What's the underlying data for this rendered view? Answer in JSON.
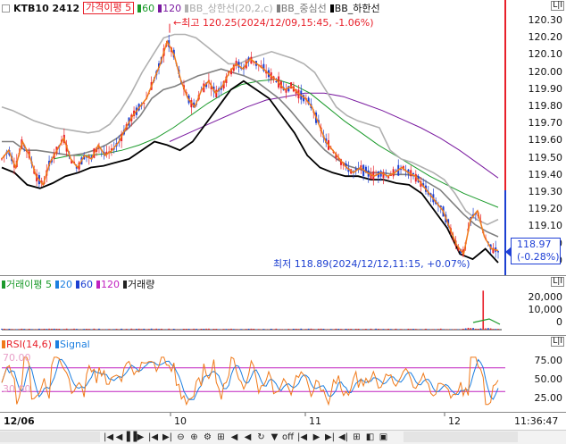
{
  "price_panel": {
    "legend": {
      "symbol": "KTB10 2412",
      "envelope": "가격이평 5",
      "ma60": "60",
      "ma120": "120",
      "bb_upper": "BB_상한선(20,2,c)",
      "bb_mid": "BB_중심선",
      "bb_lower": "BB_하한선"
    },
    "high_annotation": "←최고 120.25(2024/12/09,15:45, -1.06%)",
    "low_annotation": "최저 118.89(2024/12/12,11:15, +0.07%)",
    "current_price": "118.97",
    "current_change": "(-0.28%)",
    "axis_ticks": [
      "120.30",
      "120.20",
      "120.10",
      "120.00",
      "119.90",
      "119.80",
      "119.70",
      "119.60",
      "119.50",
      "119.40",
      "119.30",
      "119.20",
      "119.10",
      "119.00",
      "118.90"
    ]
  },
  "volume_panel": {
    "legend": {
      "title": "거래이평 5",
      "ma20": "20",
      "ma60": "60",
      "ma120": "120",
      "label": "거래량"
    },
    "axis_ticks": [
      "20,000",
      "10,000",
      "0"
    ]
  },
  "rsi_panel": {
    "legend": {
      "rsi": "RSI(14,6)",
      "signal": "Signal"
    },
    "level_high": "70.00",
    "level_low": "30.00",
    "axis_ticks": [
      "75.00",
      "50.00",
      "25.00"
    ]
  },
  "time_axis": {
    "labels": [
      "12/06",
      "10",
      "11",
      "12"
    ],
    "clock": "11:36:47"
  },
  "toolbar": {
    "buttons": [
      "|◀",
      "◀",
      "▐▐",
      "▶",
      "|◀",
      "▶|",
      "⊖",
      "⊕",
      "⚙",
      "⊞",
      "◀",
      "◀",
      "↻",
      "▼",
      "off",
      "|◀",
      "▶",
      "▶|",
      "◀|",
      "⊞",
      "◧",
      "▣"
    ]
  },
  "colors": {
    "candle_up": "#e8202a",
    "candle_down": "#1c3fd1",
    "envelope": "#f07a1a",
    "ma60": "#1a9a2a",
    "ma120": "#7a1aa0",
    "bb_upper": "#b0b0b0",
    "bb_mid": "#808080",
    "bb_lower": "#000000",
    "rsi": "#f07a1a",
    "signal": "#1c7fe0",
    "rsi_level": "#c020c0"
  },
  "chart_data": {
    "type": "candlestick",
    "price_range": [
      118.85,
      120.32
    ],
    "x_sections": [
      "12/06",
      "10",
      "11",
      "12"
    ],
    "high": {
      "value": 120.25,
      "time": "2024/12/09 15:45"
    },
    "low": {
      "value": 118.89,
      "time": "2024/12/12 11:15"
    },
    "last": 118.97,
    "close_path": [
      119.5,
      119.55,
      119.45,
      119.6,
      119.52,
      119.4,
      119.35,
      119.48,
      119.55,
      119.62,
      119.5,
      119.45,
      119.52,
      119.5,
      119.58,
      119.52,
      119.55,
      119.6,
      119.68,
      119.75,
      119.8,
      119.85,
      119.95,
      120.05,
      120.18,
      120.1,
      119.95,
      119.85,
      119.8,
      119.9,
      119.95,
      119.88,
      119.92,
      120.0,
      120.05,
      120.02,
      120.08,
      120.05,
      120.02,
      119.98,
      119.95,
      119.9,
      119.92,
      119.88,
      119.85,
      119.8,
      119.7,
      119.6,
      119.55,
      119.5,
      119.45,
      119.42,
      119.45,
      119.42,
      119.4,
      119.42,
      119.4,
      119.42,
      119.45,
      119.42,
      119.4,
      119.35,
      119.3,
      119.25,
      119.2,
      119.1,
      119.0,
      118.95,
      119.15,
      119.2,
      119.05,
      118.98,
      118.97
    ],
    "bb_upper_path": [
      119.8,
      119.78,
      119.75,
      119.72,
      119.7,
      119.68,
      119.67,
      119.66,
      119.65,
      119.66,
      119.7,
      119.78,
      119.88,
      120.0,
      120.1,
      120.2,
      120.22,
      120.22,
      120.2,
      120.15,
      120.1,
      120.05,
      120.05,
      120.08,
      120.1,
      120.12,
      120.1,
      120.08,
      120.05,
      120.0,
      119.9,
      119.8,
      119.75,
      119.72,
      119.7,
      119.68,
      119.55,
      119.5,
      119.48,
      119.45,
      119.42,
      119.38,
      119.3,
      119.2,
      119.15,
      119.12,
      119.15
    ],
    "bb_mid_path": [
      119.6,
      119.6,
      119.55,
      119.55,
      119.54,
      119.53,
      119.52,
      119.53,
      119.55,
      119.58,
      119.62,
      119.68,
      119.75,
      119.85,
      119.9,
      119.92,
      119.95,
      119.98,
      120.0,
      120.02,
      120.0,
      119.98,
      119.95,
      119.9,
      119.85,
      119.78,
      119.7,
      119.62,
      119.55,
      119.5,
      119.46,
      119.44,
      119.42,
      119.42,
      119.41,
      119.41,
      119.4,
      119.36,
      119.32,
      119.25,
      119.18,
      119.12,
      119.08,
      119.05
    ],
    "bb_lower_path": [
      119.45,
      119.42,
      119.35,
      119.33,
      119.36,
      119.4,
      119.42,
      119.45,
      119.46,
      119.48,
      119.5,
      119.55,
      119.6,
      119.58,
      119.55,
      119.6,
      119.7,
      119.8,
      119.9,
      119.95,
      119.9,
      119.85,
      119.75,
      119.65,
      119.52,
      119.45,
      119.42,
      119.4,
      119.4,
      119.38,
      119.38,
      119.36,
      119.35,
      119.3,
      119.2,
      119.1,
      118.95,
      118.92,
      118.98,
      118.9
    ],
    "ma60_path": [
      119.5,
      119.52,
      119.52,
      119.53,
      119.55,
      119.58,
      119.62,
      119.68,
      119.75,
      119.82,
      119.88,
      119.93,
      119.95,
      119.96,
      119.93,
      119.88,
      119.8,
      119.72,
      119.65,
      119.58,
      119.52,
      119.46,
      119.4,
      119.35,
      119.3,
      119.26,
      119.22
    ],
    "ma120_path": [
      119.6,
      119.65,
      119.7,
      119.75,
      119.8,
      119.84,
      119.86,
      119.88,
      119.88,
      119.86,
      119.82,
      119.78,
      119.73,
      119.68,
      119.62,
      119.55,
      119.47,
      119.39
    ],
    "volume_range": [
      0,
      28000
    ],
    "volume_spike": 26000,
    "rsi_range": [
      0,
      100
    ],
    "rsi_levels": [
      70,
      30
    ]
  }
}
